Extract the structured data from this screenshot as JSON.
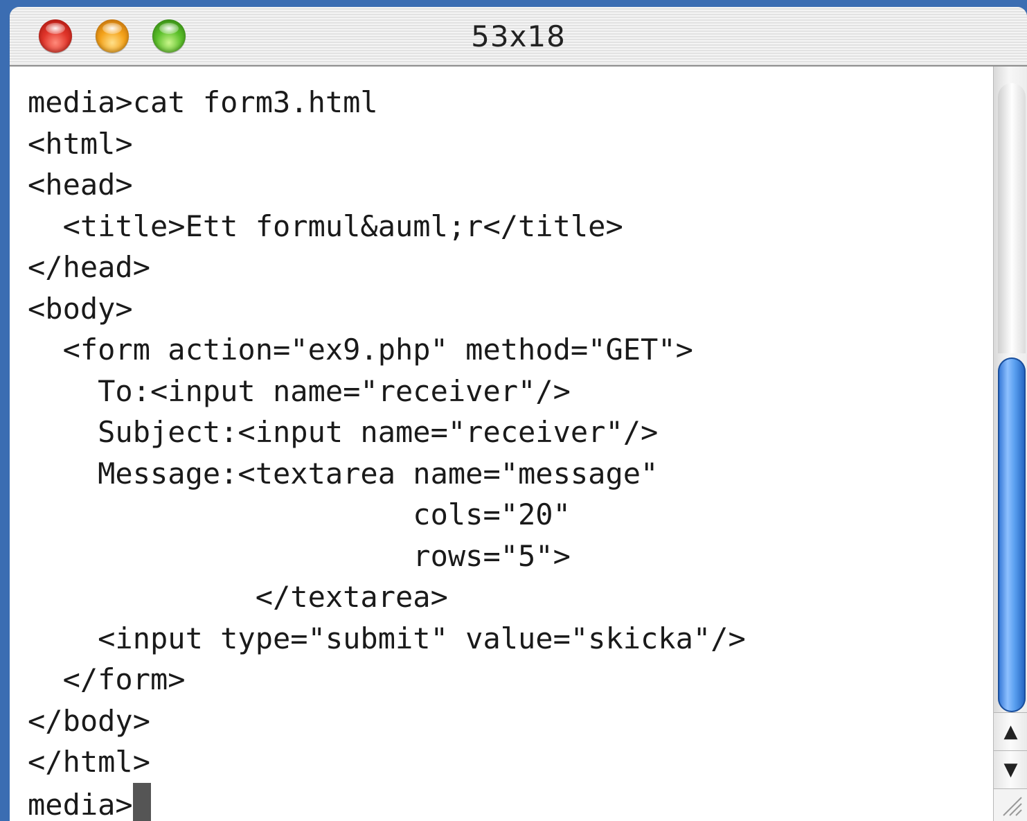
{
  "window": {
    "title": "53x18"
  },
  "terminal": {
    "lines": [
      "media>cat form3.html",
      "<html>",
      "<head>",
      "  <title>Ett formul&auml;r</title>",
      "</head>",
      "<body>",
      "  <form action=\"ex9.php\" method=\"GET\">",
      "    To:<input name=\"receiver\"/>",
      "    Subject:<input name=\"receiver\"/>",
      "    Message:<textarea name=\"message\"",
      "                      cols=\"20\"",
      "                      rows=\"5\">",
      "             </textarea>",
      "    <input type=\"submit\" value=\"skicka\"/>",
      "  </form>",
      "</body>",
      "</html>"
    ],
    "prompt": "media>"
  },
  "scrollbar": {
    "up_arrow": "▲",
    "down_arrow": "▼"
  },
  "icons": {
    "close": "close-button-icon",
    "minimize": "minimize-button-icon",
    "zoom": "zoom-button-icon",
    "resize": "resize-grip-icon"
  },
  "colors": {
    "close": "#e0352a",
    "minimize": "#f4a21a",
    "zoom": "#5bbf2a",
    "scroll_thumb": "#4a90e8",
    "text": "#1a1a1a"
  }
}
